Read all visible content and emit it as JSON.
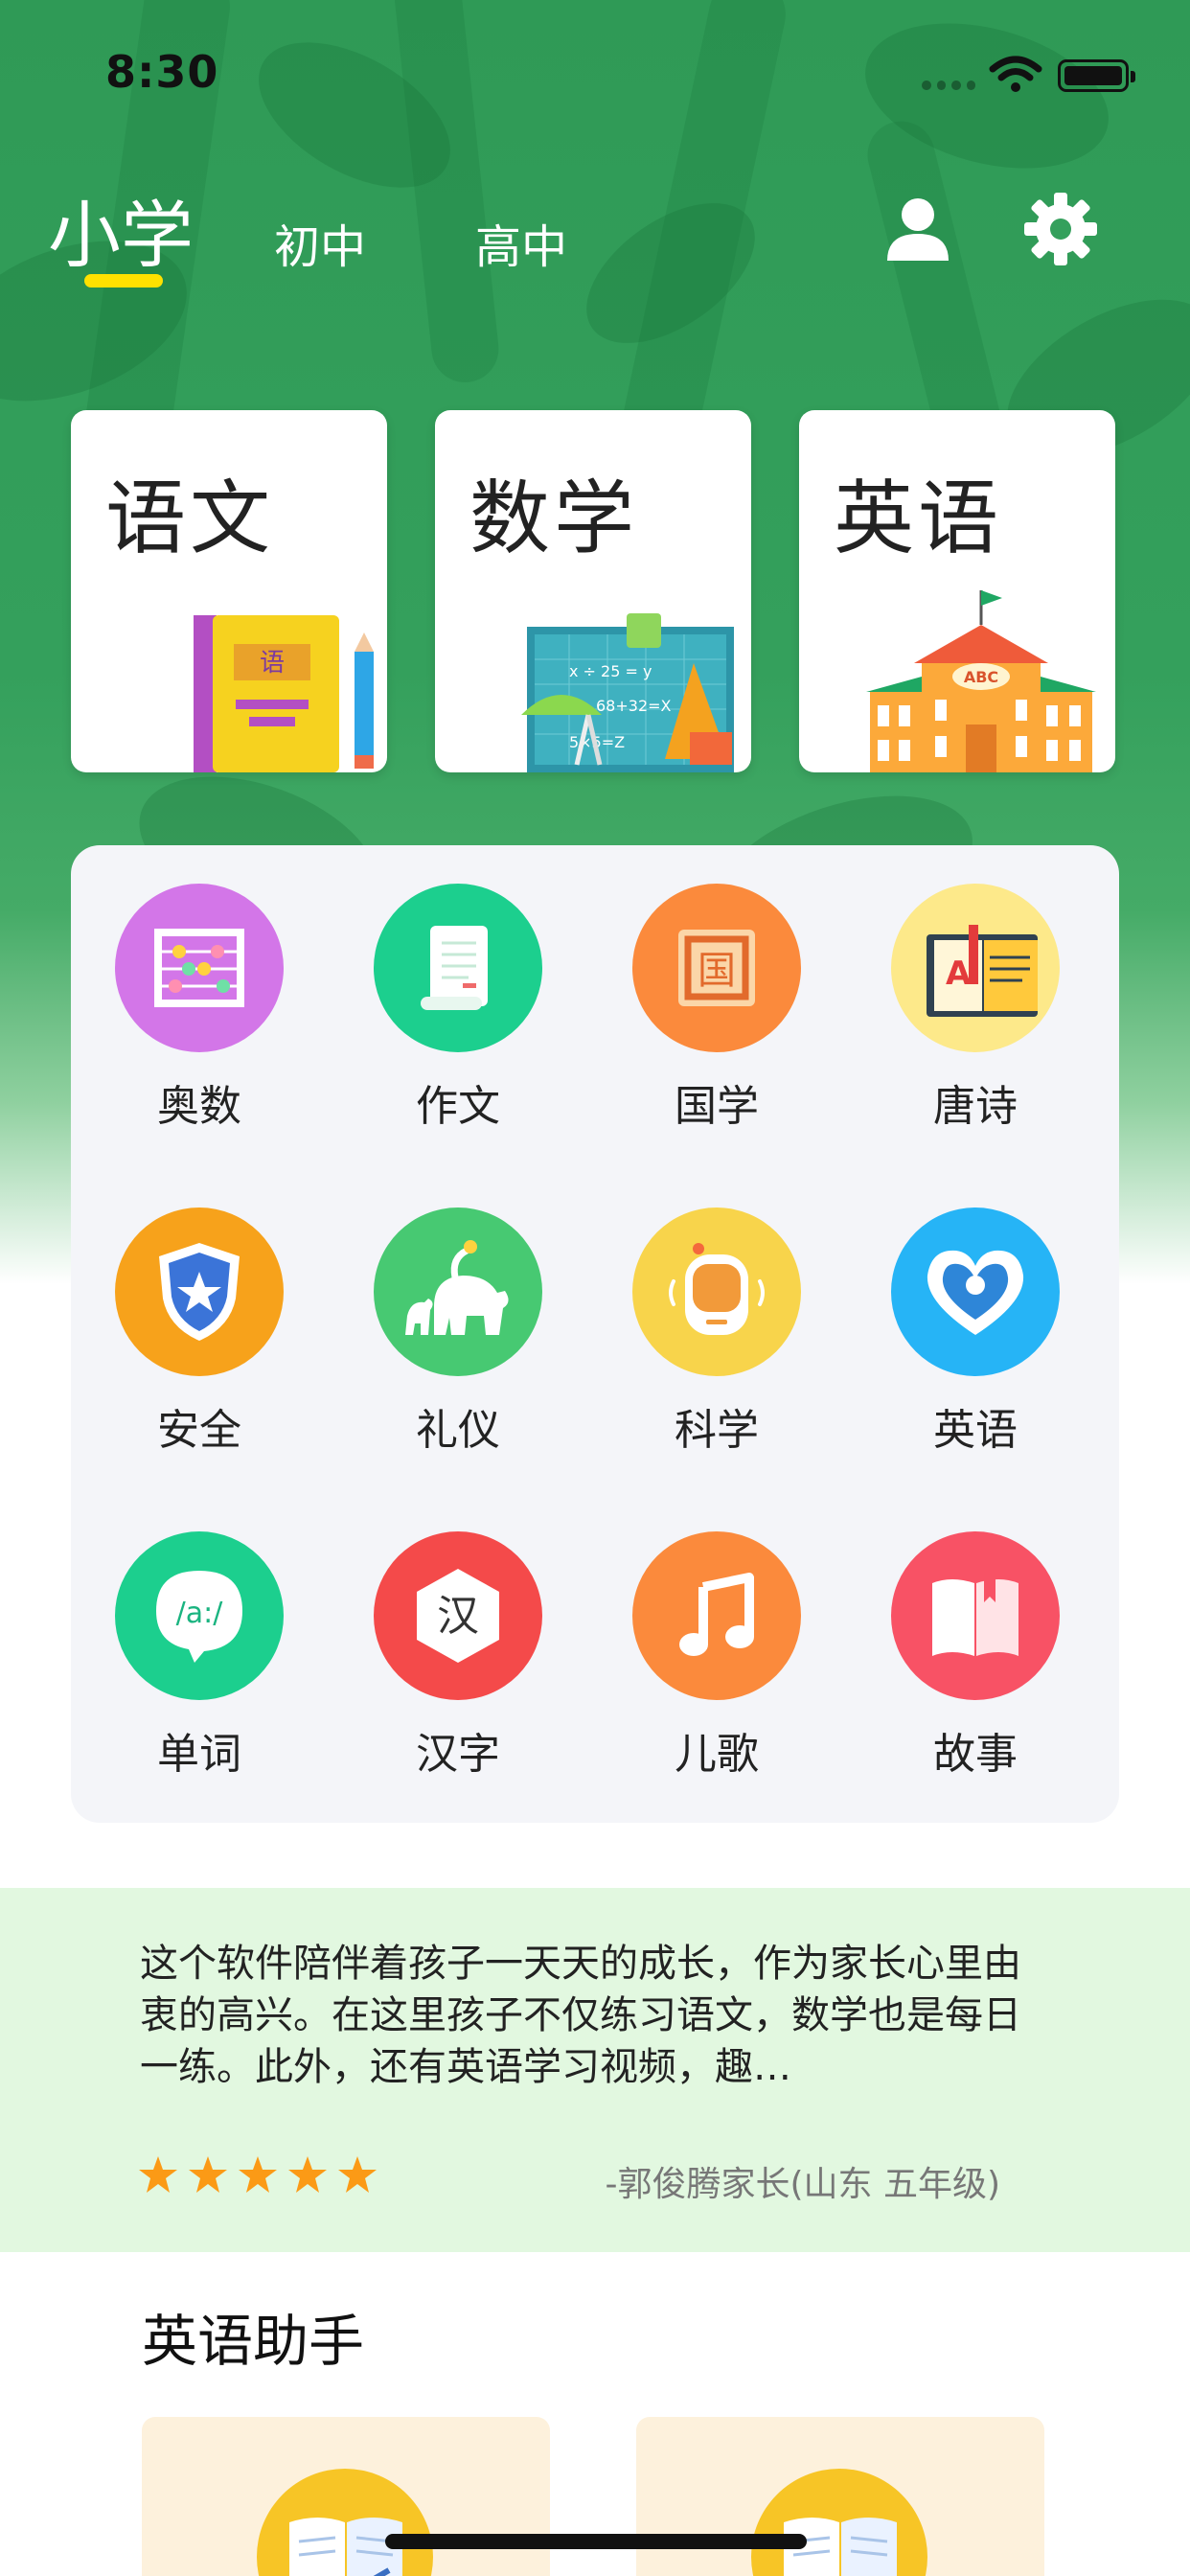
{
  "status_bar": {
    "time": "8:30"
  },
  "grade_tabs": {
    "items": [
      {
        "label": "小学",
        "selected": true
      },
      {
        "label": "初中",
        "selected": false
      },
      {
        "label": "高中",
        "selected": false
      }
    ],
    "accent_color": "#ffe100"
  },
  "header_icons": {
    "profile": "person-icon",
    "settings": "gear-icon"
  },
  "subjects": [
    {
      "title": "语文",
      "art": "book-pencil-icon"
    },
    {
      "title": "数学",
      "art": "chalkboard-ruler-icon"
    },
    {
      "title": "英语",
      "art": "school-building-icon"
    }
  ],
  "features": [
    {
      "label": "奥数",
      "icon": "abacus-icon",
      "color": "#d376e8"
    },
    {
      "label": "作文",
      "icon": "scroll-icon",
      "color": "#1ccf8e"
    },
    {
      "label": "国学",
      "icon": "seal-icon",
      "color": "#fb8a3c"
    },
    {
      "label": "唐诗",
      "icon": "poem-book-icon",
      "color": "#fde98a"
    },
    {
      "label": "安全",
      "icon": "shield-star-icon",
      "color": "#f7a21b"
    },
    {
      "label": "礼仪",
      "icon": "elephant-icon",
      "color": "#47c972"
    },
    {
      "label": "科学",
      "icon": "robot-icon",
      "color": "#f8d44b"
    },
    {
      "label": "英语",
      "icon": "heart-chat-icon",
      "color": "#26b4f6"
    },
    {
      "label": "单词",
      "icon": "phonetic-bubble-icon",
      "color": "#1ccf8e"
    },
    {
      "label": "汉字",
      "icon": "hanzi-hexagon-icon",
      "color": "#f44a4a"
    },
    {
      "label": "儿歌",
      "icon": "music-note-icon",
      "color": "#fb8a3c"
    },
    {
      "label": "故事",
      "icon": "open-book-icon",
      "color": "#f85265"
    }
  ],
  "testimonial": {
    "text": "这个软件陪伴着孩子一天天的成长，作为家长心里由衷的高兴。在这里孩子不仅练习语文，数学也是每日一练。此外，还有英语学习视频，趣…",
    "rating": 5,
    "author": "-郭俊腾家长(山东 五年级)",
    "background": "#e2f8e0",
    "star_color": "#fb9a16"
  },
  "english_helper": {
    "title": "英语助手",
    "cards": [
      {
        "icon": "reading-book-icon"
      },
      {
        "icon": "reading-book-icon"
      }
    ]
  }
}
